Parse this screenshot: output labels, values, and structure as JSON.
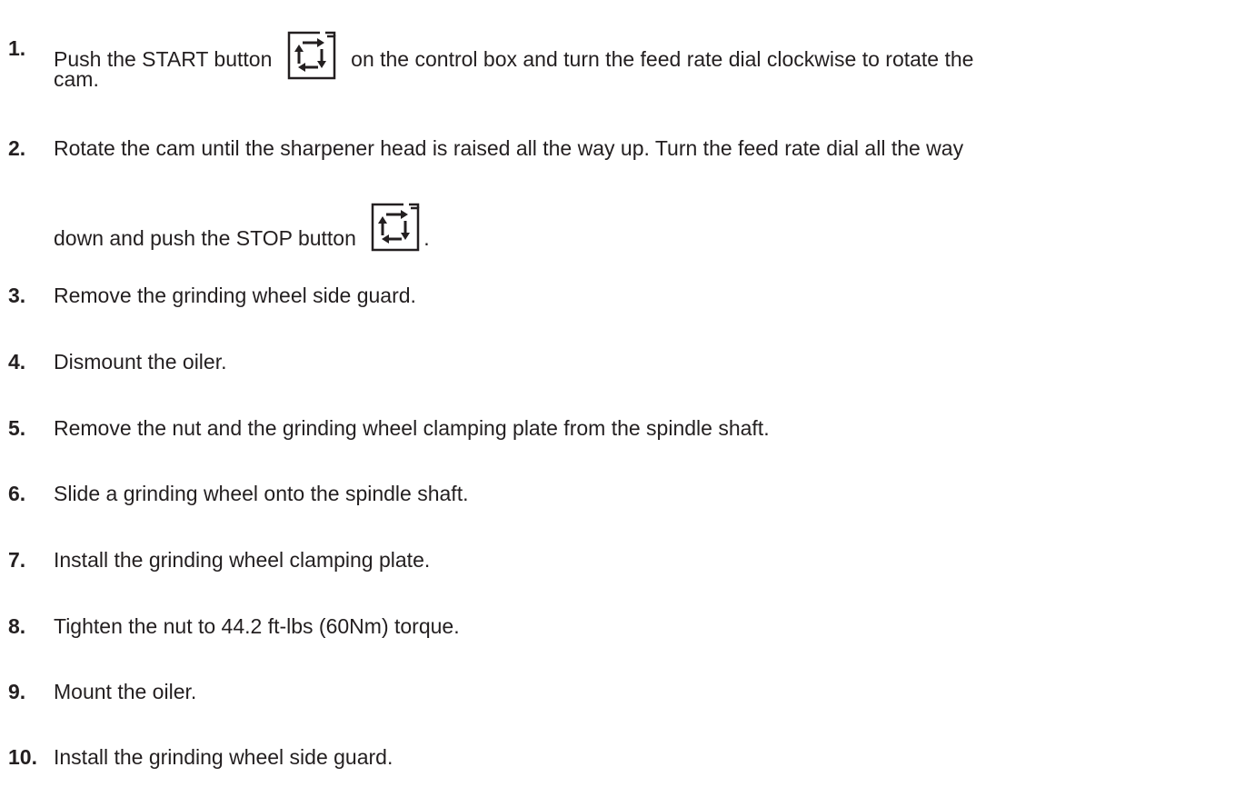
{
  "steps": [
    {
      "num": "1.",
      "pre": "Push the START button",
      "post": "on the control box and turn the feed rate dial clockwise to rotate the",
      "cont": "cam."
    },
    {
      "num": "2.",
      "pre": "Rotate the cam until the sharpener head is raised all the way up. Turn the feed rate dial all the way",
      "cont_pre": "down and push the STOP button",
      "cont_post": "."
    },
    {
      "num": "3.",
      "text": "Remove the grinding wheel side guard."
    },
    {
      "num": "4.",
      "text": "Dismount the oiler."
    },
    {
      "num": "5.",
      "text": "Remove the nut and the grinding wheel clamping plate from the spindle shaft."
    },
    {
      "num": "6.",
      "text": "Slide a grinding wheel onto the spindle shaft."
    },
    {
      "num": "7.",
      "text": "Install the grinding wheel clamping plate."
    },
    {
      "num": "8.",
      "text": "Tighten the nut to 44.2 ft-lbs (60Nm) torque."
    },
    {
      "num": "9.",
      "text": "Mount the oiler."
    },
    {
      "num": "10.",
      "text": "Install the grinding wheel side guard."
    }
  ],
  "icons": {
    "start": "cycle-arrows-icon",
    "stop": "cycle-arrows-icon"
  }
}
